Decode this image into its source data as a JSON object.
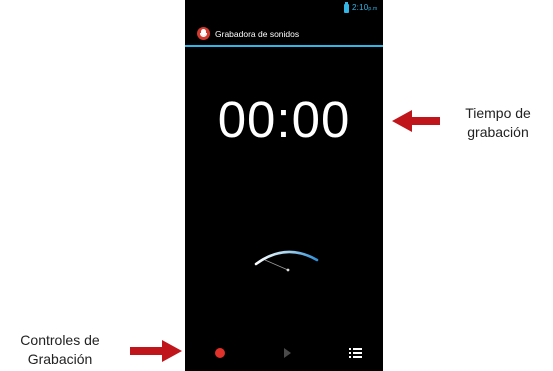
{
  "status_bar": {
    "time": "2:10",
    "ampm": "p.m"
  },
  "app": {
    "title": "Grabadora de sonidos",
    "icon": "microphone-icon"
  },
  "timer": {
    "value": "00:00"
  },
  "level_meter": {
    "level": 0
  },
  "controls": {
    "record": "record-icon",
    "play": "play-icon",
    "list": "list-icon"
  },
  "annotations": {
    "time_label_line1": "Tiempo de",
    "time_label_line2": "grabación",
    "controls_label_line1": "Controles de",
    "controls_label_line2": "Grabación"
  },
  "colors": {
    "accent": "#33b5e5",
    "record": "#e0312a",
    "arrow": "#c0151b",
    "screen_bg": "#000000"
  }
}
